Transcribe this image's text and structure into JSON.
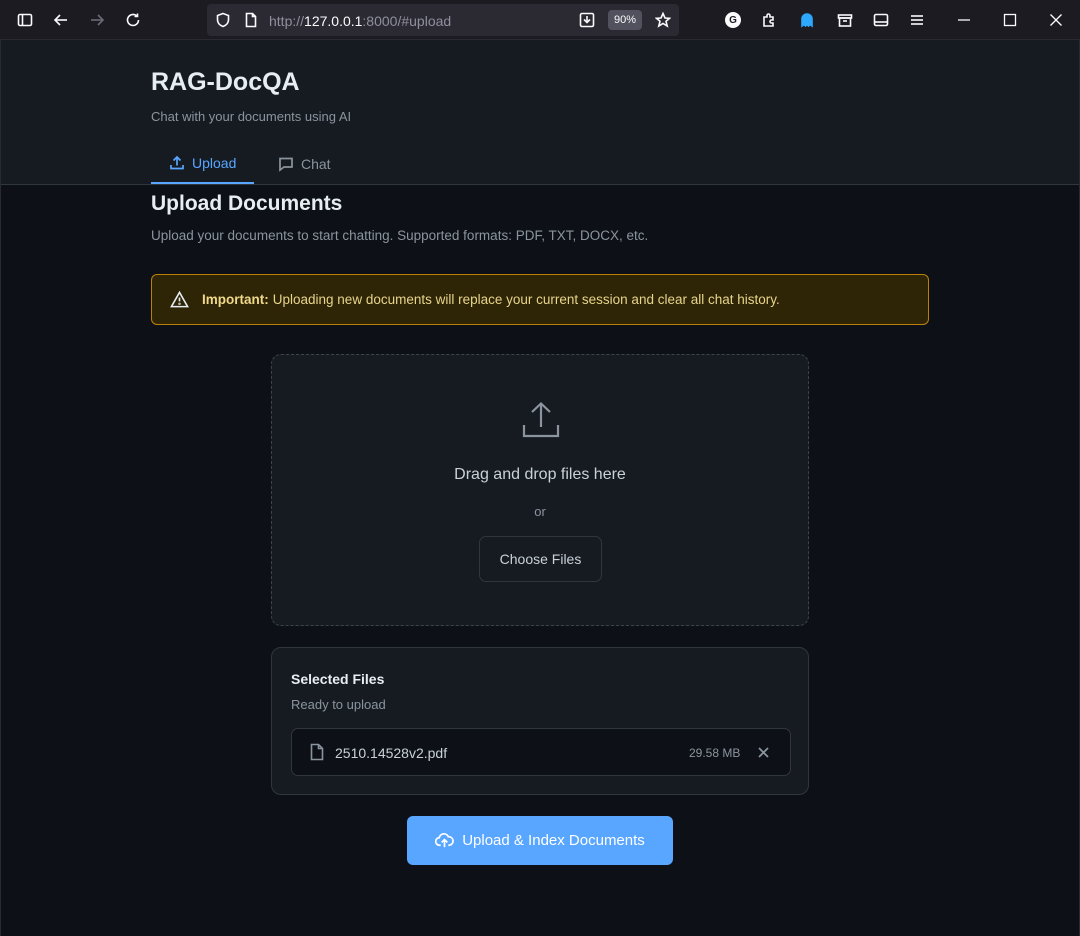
{
  "browser": {
    "url_prefix": "http://",
    "url_host": "127.0.0.1",
    "url_rest": ":8000/#upload",
    "zoom": "90%",
    "extension_badge": "G"
  },
  "header": {
    "title": "RAG-DocQA",
    "subtitle": "Chat with your documents using AI",
    "tabs": [
      {
        "label": "Upload",
        "active": true
      },
      {
        "label": "Chat",
        "active": false
      }
    ]
  },
  "main": {
    "title": "Upload Documents",
    "description": "Upload your documents to start chatting. Supported formats: PDF, TXT, DOCX, etc.",
    "warning": {
      "label": "Important:",
      "message": "Uploading new documents will replace your current session and clear all chat history."
    },
    "dropzone": {
      "text": "Drag and drop files here",
      "or": "or",
      "button": "Choose Files"
    },
    "selected": {
      "title": "Selected Files",
      "subtitle": "Ready to upload",
      "files": [
        {
          "name": "2510.14528v2.pdf",
          "size": "29.58 MB"
        }
      ]
    },
    "upload_button": "Upload & Index Documents"
  },
  "colors": {
    "accent": "#58a6ff",
    "background": "#0d1117",
    "warning_border": "#bb8009"
  }
}
